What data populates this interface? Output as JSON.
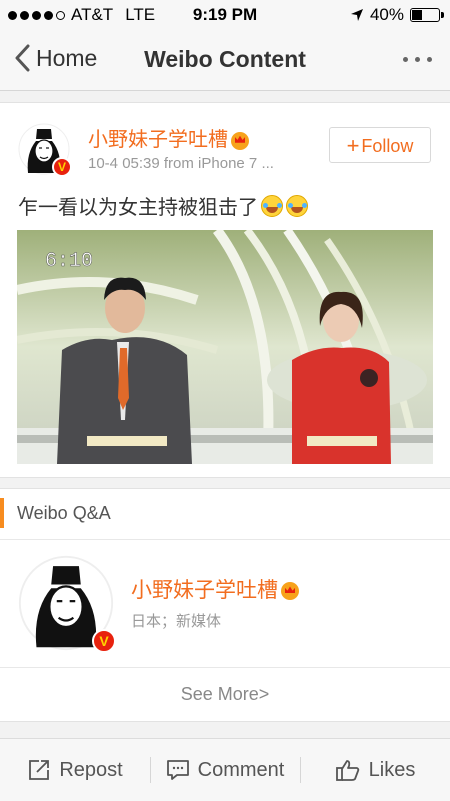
{
  "status_bar": {
    "carrier": "AT&T",
    "network": "LTE",
    "time": "9:19 PM",
    "battery_text": "40%",
    "battery_level": 0.4,
    "signal_bars": 4,
    "icons": [
      "signal-dots-icon",
      "location-arrow-icon",
      "battery-icon"
    ]
  },
  "nav": {
    "back_label": "Home",
    "title": "Weibo Content",
    "icons": [
      "chevron-left-icon",
      "more-icon"
    ]
  },
  "post": {
    "author": "小野妹子学吐槽",
    "meta": "10-4 05:39  from iPhone 7 ...",
    "follow_label": "Follow",
    "text": "乍一看以为女主持被狙击了",
    "photo_timestamp": "6:10",
    "icons": [
      "avatar-portrait-icon",
      "verified-v-icon",
      "crown-badge-icon",
      "laughing-emoji-icon",
      "plus-icon"
    ]
  },
  "qa": {
    "title": "Weibo Q&A",
    "user_name": "小野妹子学吐槽",
    "user_desc": "日本；新媒体",
    "see_more": "See More>"
  },
  "bottom_bar": {
    "repost": "Repost",
    "comment": "Comment",
    "likes": "Likes",
    "icons": [
      "repost-icon",
      "comment-icon",
      "thumbs-up-icon"
    ]
  },
  "colors": {
    "accent_orange": "#f26d1f",
    "qa_bar": "#f78c1f",
    "verified_red": "#e8220e"
  }
}
